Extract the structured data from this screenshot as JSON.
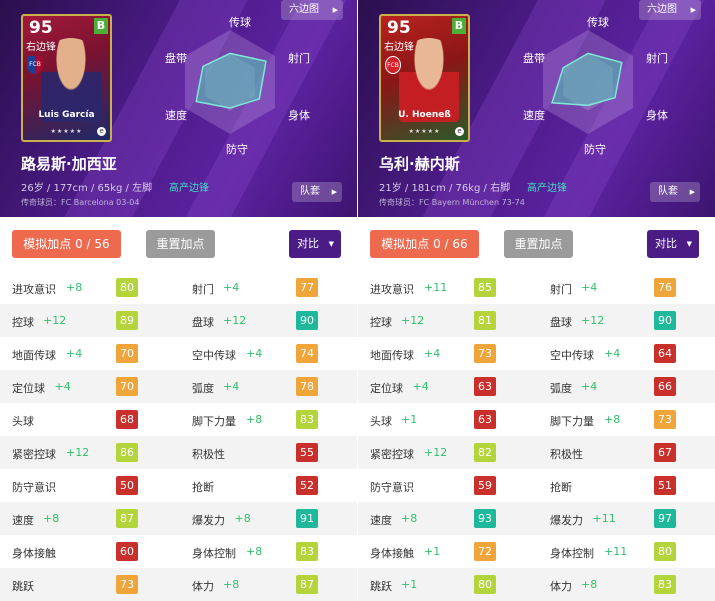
{
  "colors": {
    "purple": "#4b1b86",
    "orange": "#ee6a4f",
    "grey": "#9b9b9b",
    "green_text": "#2fbf6b",
    "teal_tag": "#3ee0c0"
  },
  "tier_colors": {
    "red": "#c9302c",
    "orange": "#f0a53b",
    "yellow": "#b4d43c",
    "green": "#56c63a",
    "teal": "#1fb89a"
  },
  "common": {
    "hex_label": "六边图",
    "squad_label": "队套",
    "reset_label": "重置加点",
    "compare_label": "对比",
    "radar_labels": {
      "top": "传球",
      "top_right": "射门",
      "bottom_right": "身体",
      "bottom": "防守",
      "bottom_left": "速度",
      "top_left": "盘带"
    },
    "stars": "★★★★★",
    "grade": "B"
  },
  "players": [
    {
      "card_style": "barca",
      "rating": "95",
      "position": "右边锋",
      "card_name": "Luis García",
      "name": "路易斯·加西亚",
      "info": "26岁 / 177cm / 65kg / 左脚",
      "tag": "高产边锋",
      "club": "传奇球员：FC Barcelona 03-04",
      "sim_label": "模拟加点 0 / 56",
      "crest": "FCB",
      "radar": [
        0.55,
        0.8,
        0.65,
        0.5,
        0.75,
        0.6
      ],
      "stats": [
        [
          {
            "n": "进攻意识",
            "b": "+8",
            "v": 80,
            "t": "yellow"
          },
          {
            "n": "射门",
            "b": "+4",
            "v": 77,
            "t": "orange"
          }
        ],
        [
          {
            "n": "控球",
            "b": "+12",
            "v": 89,
            "t": "yellow"
          },
          {
            "n": "盘球",
            "b": "+12",
            "v": 90,
            "t": "teal"
          }
        ],
        [
          {
            "n": "地面传球",
            "b": "+4",
            "v": 70,
            "t": "orange"
          },
          {
            "n": "空中传球",
            "b": "+4",
            "v": 74,
            "t": "orange"
          }
        ],
        [
          {
            "n": "定位球",
            "b": "+4",
            "v": 70,
            "t": "orange"
          },
          {
            "n": "弧度",
            "b": "+4",
            "v": 78,
            "t": "orange"
          }
        ],
        [
          {
            "n": "头球",
            "b": "",
            "v": 68,
            "t": "red"
          },
          {
            "n": "脚下力量",
            "b": "+8",
            "v": 83,
            "t": "yellow"
          }
        ],
        [
          {
            "n": "紧密控球",
            "b": "+12",
            "v": 86,
            "t": "yellow"
          },
          {
            "n": "积极性",
            "b": "",
            "v": 55,
            "t": "red"
          }
        ],
        [
          {
            "n": "防守意识",
            "b": "",
            "v": 50,
            "t": "red"
          },
          {
            "n": "抢断",
            "b": "",
            "v": 52,
            "t": "red"
          }
        ],
        [
          {
            "n": "速度",
            "b": "+8",
            "v": 87,
            "t": "yellow"
          },
          {
            "n": "爆发力",
            "b": "+8",
            "v": 91,
            "t": "teal"
          }
        ],
        [
          {
            "n": "身体接触",
            "b": "",
            "v": 60,
            "t": "red"
          },
          {
            "n": "身体控制",
            "b": "+8",
            "v": 83,
            "t": "yellow"
          }
        ],
        [
          {
            "n": "跳跃",
            "b": "",
            "v": 73,
            "t": "orange"
          },
          {
            "n": "体力",
            "b": "+8",
            "v": 87,
            "t": "yellow"
          }
        ]
      ]
    },
    {
      "card_style": "bayern",
      "rating": "95",
      "position": "右边锋",
      "card_name": "U. Hoeneß",
      "name": "乌利·赫内斯",
      "info": "21岁 / 181cm / 76kg / 右脚",
      "tag": "高产边锋",
      "club": "传奇球员：FC Bayern München 73-74",
      "sim_label": "模拟加点 0 / 66",
      "crest": "FCB",
      "radar": [
        0.55,
        0.75,
        0.6,
        0.45,
        0.8,
        0.55
      ],
      "stats": [
        [
          {
            "n": "进攻意识",
            "b": "+11",
            "v": 85,
            "t": "yellow"
          },
          {
            "n": "射门",
            "b": "+4",
            "v": 76,
            "t": "orange"
          }
        ],
        [
          {
            "n": "控球",
            "b": "+12",
            "v": 81,
            "t": "yellow"
          },
          {
            "n": "盘球",
            "b": "+12",
            "v": 90,
            "t": "teal"
          }
        ],
        [
          {
            "n": "地面传球",
            "b": "+4",
            "v": 73,
            "t": "orange"
          },
          {
            "n": "空中传球",
            "b": "+4",
            "v": 64,
            "t": "red"
          }
        ],
        [
          {
            "n": "定位球",
            "b": "+4",
            "v": 63,
            "t": "red"
          },
          {
            "n": "弧度",
            "b": "+4",
            "v": 66,
            "t": "red"
          }
        ],
        [
          {
            "n": "头球",
            "b": "+1",
            "v": 63,
            "t": "red"
          },
          {
            "n": "脚下力量",
            "b": "+8",
            "v": 73,
            "t": "orange"
          }
        ],
        [
          {
            "n": "紧密控球",
            "b": "+12",
            "v": 82,
            "t": "yellow"
          },
          {
            "n": "积极性",
            "b": "",
            "v": 67,
            "t": "red"
          }
        ],
        [
          {
            "n": "防守意识",
            "b": "",
            "v": 59,
            "t": "red"
          },
          {
            "n": "抢断",
            "b": "",
            "v": 51,
            "t": "red"
          }
        ],
        [
          {
            "n": "速度",
            "b": "+8",
            "v": 93,
            "t": "teal"
          },
          {
            "n": "爆发力",
            "b": "+11",
            "v": 97,
            "t": "teal"
          }
        ],
        [
          {
            "n": "身体接触",
            "b": "+1",
            "v": 72,
            "t": "orange"
          },
          {
            "n": "身体控制",
            "b": "+11",
            "v": 80,
            "t": "yellow"
          }
        ],
        [
          {
            "n": "跳跃",
            "b": "+1",
            "v": 80,
            "t": "yellow"
          },
          {
            "n": "体力",
            "b": "+8",
            "v": 83,
            "t": "yellow"
          }
        ]
      ]
    }
  ]
}
